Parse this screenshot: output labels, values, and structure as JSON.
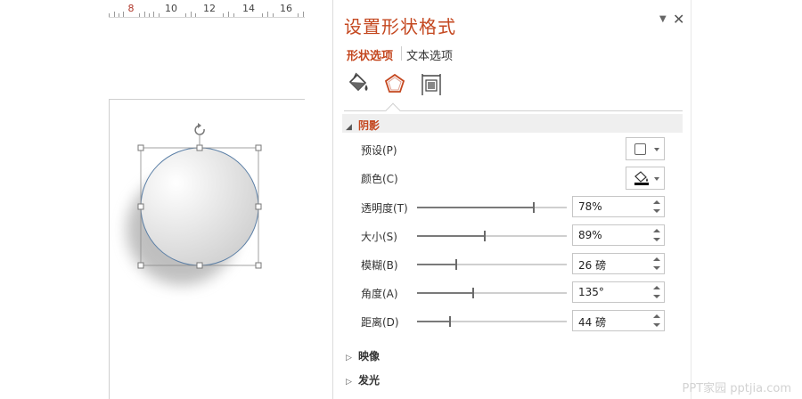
{
  "ruler": {
    "current_mark": "8",
    "numbers": [
      "10",
      "12",
      "14",
      "16"
    ]
  },
  "pane": {
    "title": "设置形状格式",
    "collapse_icon": "caret-down-icon",
    "close_label": "✕",
    "tabs": [
      {
        "label": "形状选项",
        "selected": true
      },
      {
        "label": "文本选项",
        "selected": false
      }
    ],
    "icon_tabs": [
      "fill-line-icon",
      "effects-icon",
      "size-properties-icon"
    ],
    "accent_color": "#c4471f"
  },
  "shadow_section": {
    "title": "阴影",
    "preset_label": "预设(P)",
    "color_label": "颜色(C)",
    "rows": [
      {
        "label": "透明度(T)",
        "value": "78%",
        "level": 0.78
      },
      {
        "label": "大小(S)",
        "value": "89%",
        "level": 0.45
      },
      {
        "label": "模糊(B)",
        "value": "26 磅",
        "level": 0.26
      },
      {
        "label": "角度(A)",
        "value": "135°",
        "level": 0.375
      },
      {
        "label": "距离(D)",
        "value": "44 磅",
        "level": 0.22
      }
    ]
  },
  "collapsed_sections": [
    "映像",
    "发光"
  ],
  "watermark": "PPT家园 pptjia.com"
}
